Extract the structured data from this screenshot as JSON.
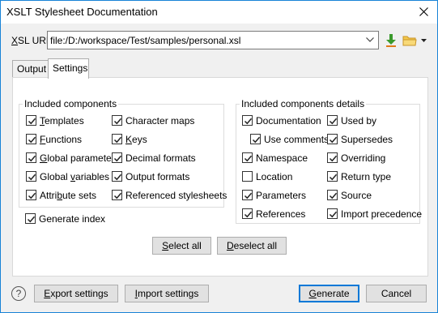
{
  "window": {
    "title": "XSLT Stylesheet Documentation"
  },
  "url": {
    "label_ul": "X",
    "label_rest": "SL URL:",
    "value": "file:/D:/workspace/Test/samples/personal.xsl"
  },
  "tabs": [
    {
      "label": "Output",
      "active": false
    },
    {
      "label": "Settings",
      "active": true
    }
  ],
  "included_components": {
    "title": "Included components",
    "items": [
      {
        "ul": "T",
        "rest": "emplates",
        "checked": true
      },
      {
        "ul": "F",
        "rest": "unctions",
        "checked": true
      },
      {
        "ul": "G",
        "rest": "lobal parameter",
        "checked": true
      },
      {
        "ul": "",
        "pre": "Global ",
        "ul2": "v",
        "rest": "ariables",
        "checked": true
      },
      {
        "ul": "",
        "pre": "Attri",
        "ul2": "b",
        "rest": "ute sets",
        "checked": true
      },
      {
        "ul": "",
        "pre": "Character maps",
        "ul2": "",
        "rest": "",
        "checked": true
      },
      {
        "ul": "K",
        "rest": "eys",
        "checked": true
      },
      {
        "ul": "",
        "pre": "Decimal formats",
        "ul2": "",
        "rest": "",
        "checked": true
      },
      {
        "ul": "",
        "pre": "Output formats",
        "ul2": "",
        "rest": "",
        "checked": true
      },
      {
        "ul": "",
        "pre": "Referenced stylesheets",
        "ul2": "",
        "rest": "",
        "checked": true
      }
    ]
  },
  "details": {
    "title": "Included components details",
    "items": [
      {
        "label": "Documentation",
        "checked": true
      },
      {
        "label": "Use comments",
        "checked": true
      },
      {
        "label": "Namespace",
        "checked": true
      },
      {
        "label": "Location",
        "checked": false
      },
      {
        "label": "Parameters",
        "checked": true
      },
      {
        "label": "References",
        "checked": true
      },
      {
        "label": "Used by",
        "checked": true
      },
      {
        "label": "Supersedes",
        "checked": true
      },
      {
        "label": "Overriding",
        "checked": true
      },
      {
        "label": "Return type",
        "checked": true
      },
      {
        "label": "Source",
        "checked": true
      },
      {
        "label": "Import precedence",
        "checked": true
      }
    ]
  },
  "generate_index": {
    "label": "Generate index",
    "checked": true
  },
  "buttons": {
    "select_all_ul": "S",
    "select_all_rest": "elect all",
    "deselect_all_ul": "D",
    "deselect_all_rest": "eselect all",
    "export_ul": "E",
    "export_rest": "xport settings",
    "import_ul": "I",
    "import_rest": "mport settings",
    "generate_ul": "G",
    "generate_rest": "enerate",
    "cancel": "Cancel",
    "help": "?"
  }
}
